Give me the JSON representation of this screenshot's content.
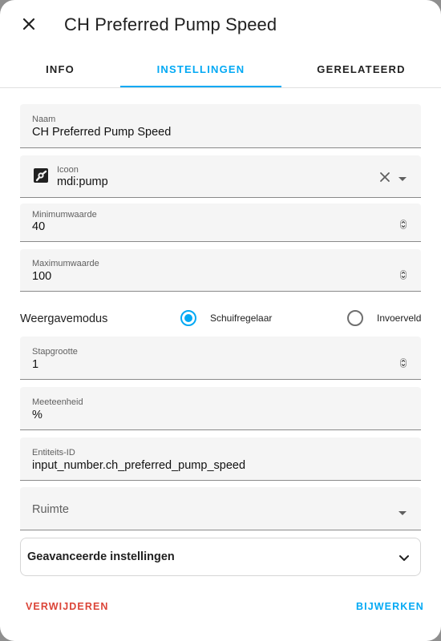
{
  "dialog": {
    "title": "CH Preferred Pump Speed",
    "tabs": [
      {
        "label": "INFO"
      },
      {
        "label": "INSTELLINGEN"
      },
      {
        "label": "GERELATEERD"
      }
    ],
    "active_tab": "INSTELLINGEN"
  },
  "form": {
    "name": {
      "label": "Naam",
      "value": "CH Preferred Pump Speed"
    },
    "icon": {
      "label": "Icoon",
      "value": "mdi:pump",
      "icon": "pump-icon"
    },
    "min": {
      "label": "Minimumwaarde",
      "value": "40"
    },
    "max": {
      "label": "Maximumwaarde",
      "value": "100"
    },
    "display_mode": {
      "label": "Weergavemodus",
      "options": [
        {
          "label": "Schuifregelaar",
          "selected": true
        },
        {
          "label": "Invoerveld",
          "selected": false
        }
      ]
    },
    "step": {
      "label": "Stapgrootte",
      "value": "1"
    },
    "unit": {
      "label": "Meeteenheid",
      "value": "%"
    },
    "entity_id": {
      "label": "Entiteits-ID",
      "value": "input_number.ch_preferred_pump_speed"
    },
    "area": {
      "placeholder": "Ruimte",
      "value": ""
    },
    "advanced": {
      "label": "Geavanceerde instellingen"
    }
  },
  "footer": {
    "delete_label": "VERWIJDEREN",
    "update_label": "BIJWERKEN"
  },
  "colors": {
    "accent": "#03a9f4",
    "danger": "#db4437",
    "field_bg": "#f5f5f5"
  }
}
